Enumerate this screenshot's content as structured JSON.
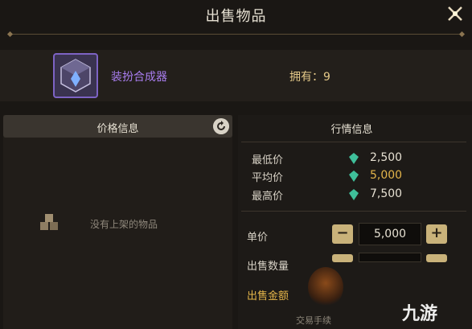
{
  "title": "出售物品",
  "item": {
    "name": "装扮合成器",
    "owned_label": "拥有：9",
    "icon": "cube-crystal-icon"
  },
  "left_panel": {
    "header": "价格信息",
    "empty_text": "没有上架的物品",
    "refresh_icon": "refresh-icon"
  },
  "market": {
    "header": "行情信息",
    "rows": [
      {
        "label": "最低价",
        "value": "2,500",
        "color": "#e6e0d2"
      },
      {
        "label": "平均价",
        "value": "5,000",
        "color": "#e4b54a"
      },
      {
        "label": "最高价",
        "value": "7,500",
        "color": "#e6e0d2"
      }
    ]
  },
  "form": {
    "unit_price_label": "单价",
    "unit_price_value": "5,000",
    "quantity_label": "出售数量",
    "total_label": "出售金额",
    "minus": "−",
    "plus": "+"
  },
  "footer": {
    "fee_text": "交易手续"
  },
  "watermark": "九游",
  "colors": {
    "accent_purple": "#a97ef0",
    "gold": "#e4b54a",
    "gem": "#3fbf9a"
  }
}
